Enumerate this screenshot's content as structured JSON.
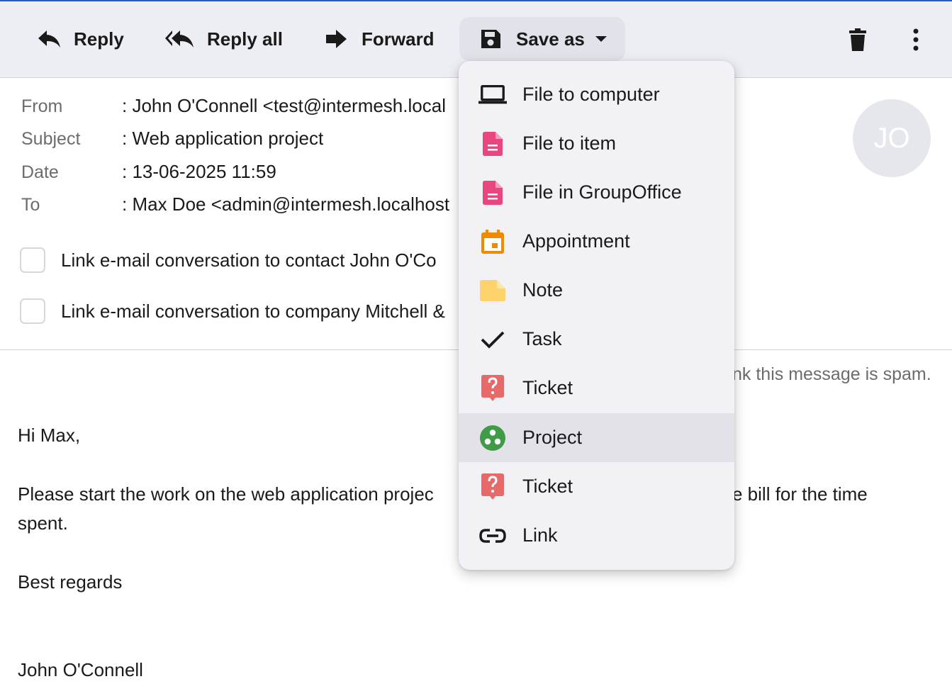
{
  "toolbar": {
    "reply_label": "Reply",
    "reply_all_label": "Reply all",
    "forward_label": "Forward",
    "save_as_label": "Save as"
  },
  "header": {
    "from_label": "From",
    "from_value": ": John O'Connell <test@intermesh.local",
    "subject_label": "Subject",
    "subject_value": ": Web application project",
    "date_label": "Date",
    "date_value": ": 13-06-2025 11:59",
    "to_label": "To",
    "to_value": ": Max Doe <admin@intermesh.localhost",
    "avatar_initials": "JO"
  },
  "links": {
    "contact_label": "Link e-mail conversation to contact John O'Co",
    "company_label": "Link e-mail conversation to company Mitchell &"
  },
  "spam_notice": "nk this message is spam.",
  "message": {
    "greeting": "Hi Max,",
    "line1_left": "Please start the work on the web application projec",
    "line1_right": "e bill for the time",
    "line2": "spent.",
    "closing": "Best regards",
    "signature": "John O'Connell"
  },
  "save_menu": {
    "items": [
      {
        "label": "File to computer",
        "icon": "laptop-icon"
      },
      {
        "label": "File to item",
        "icon": "document-pink-icon"
      },
      {
        "label": "File in GroupOffice",
        "icon": "document-pink-icon"
      },
      {
        "label": "Appointment",
        "icon": "calendar-orange-icon"
      },
      {
        "label": "Note",
        "icon": "note-yellow-icon"
      },
      {
        "label": "Task",
        "icon": "check-icon"
      },
      {
        "label": "Ticket",
        "icon": "ticket-red-icon"
      },
      {
        "label": "Project",
        "icon": "project-green-icon"
      },
      {
        "label": "Ticket",
        "icon": "ticket-red-icon"
      },
      {
        "label": "Link",
        "icon": "link-icon"
      }
    ],
    "highlighted_index": 7
  },
  "colors": {
    "accent_top": "#1f5fb8",
    "toolbar_bg": "#eceef4",
    "doc_pink": "#e8467e",
    "calendar_orange": "#f08a00",
    "note_yellow": "#ffd36b",
    "ticket_red": "#e66a6a",
    "project_green": "#3f9b48"
  }
}
